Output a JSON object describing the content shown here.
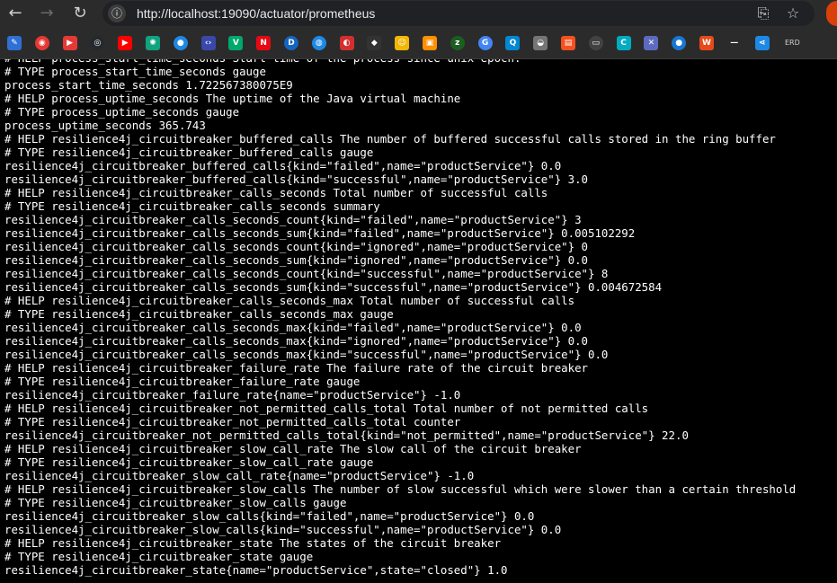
{
  "address_bar": {
    "url": "http://localhost:19090/actuator/prometheus"
  },
  "bookmarks": [
    {
      "name": "bookmark-editor-icon",
      "glyph": "✎",
      "color": "#2f6fd6"
    },
    {
      "name": "bookmark-mail-icon",
      "glyph": "◉",
      "color": "#e53935"
    },
    {
      "name": "bookmark-music-icon",
      "glyph": "▶",
      "color": "#e53935"
    },
    {
      "name": "bookmark-github-icon",
      "glyph": "◎",
      "color": "#24292e"
    },
    {
      "name": "bookmark-youtube-icon",
      "glyph": "▶",
      "color": "#ff0000"
    },
    {
      "name": "bookmark-ai-icon",
      "glyph": "✺",
      "color": "#10a37f"
    },
    {
      "name": "bookmark-globe-icon",
      "glyph": "●",
      "color": "#1e88e5"
    },
    {
      "name": "bookmark-code-icon",
      "glyph": "‹›",
      "color": "#3949ab"
    },
    {
      "name": "bookmark-v-icon",
      "glyph": "V",
      "color": "#00a86b"
    },
    {
      "name": "bookmark-netflix-icon",
      "glyph": "N",
      "color": "#e50914"
    },
    {
      "name": "bookmark-d-icon",
      "glyph": "D",
      "color": "#1565c0"
    },
    {
      "name": "bookmark-circle-icon",
      "glyph": "◍",
      "color": "#1e88e5"
    },
    {
      "name": "bookmark-red-icon",
      "glyph": "◐",
      "color": "#d32f2f"
    },
    {
      "name": "bookmark-diamond-icon",
      "glyph": "◆",
      "color": "#333333"
    },
    {
      "name": "bookmark-emoji-icon",
      "glyph": "☺",
      "color": "#f2b705"
    },
    {
      "name": "bookmark-image-icon",
      "glyph": "▣",
      "color": "#ff8f00"
    },
    {
      "name": "bookmark-z-icon",
      "glyph": "z",
      "color": "#1b5e20"
    },
    {
      "name": "bookmark-translate-icon",
      "glyph": "G",
      "color": "#4285f4"
    },
    {
      "name": "bookmark-q-icon",
      "glyph": "Q",
      "color": "#0288d1"
    },
    {
      "name": "bookmark-web-icon",
      "glyph": "◒",
      "color": "#757575"
    },
    {
      "name": "bookmark-box-icon",
      "glyph": "▤",
      "color": "#f4511e"
    },
    {
      "name": "bookmark-laptop-icon",
      "glyph": "▭",
      "color": "#424242"
    },
    {
      "name": "bookmark-c-icon",
      "glyph": "C",
      "color": "#00acc1"
    },
    {
      "name": "bookmark-cross-icon",
      "glyph": "✕",
      "color": "#5c6bc0"
    },
    {
      "name": "bookmark-sphere-icon",
      "glyph": "●",
      "color": "#1976d2"
    },
    {
      "name": "bookmark-w-icon",
      "glyph": "W",
      "color": "#e64a19"
    },
    {
      "name": "bookmark-dash-icon",
      "glyph": "—",
      "color": "#2b2b2b"
    },
    {
      "name": "bookmark-share-icon",
      "glyph": "⋖",
      "color": "#1e88e5"
    },
    {
      "name": "bookmark-erd",
      "glyph": "ERD",
      "color": "#2b2b2b"
    }
  ],
  "metrics_lines": [
    "# HELP process_start_time_seconds Start time of the process since unix epoch.",
    "# TYPE process_start_time_seconds gauge",
    "process_start_time_seconds 1.722567380075E9",
    "# HELP process_uptime_seconds The uptime of the Java virtual machine",
    "# TYPE process_uptime_seconds gauge",
    "process_uptime_seconds 365.743",
    "# HELP resilience4j_circuitbreaker_buffered_calls The number of buffered successful calls stored in the ring buffer",
    "# TYPE resilience4j_circuitbreaker_buffered_calls gauge",
    "resilience4j_circuitbreaker_buffered_calls{kind=\"failed\",name=\"productService\"} 0.0",
    "resilience4j_circuitbreaker_buffered_calls{kind=\"successful\",name=\"productService\"} 3.0",
    "# HELP resilience4j_circuitbreaker_calls_seconds Total number of successful calls",
    "# TYPE resilience4j_circuitbreaker_calls_seconds summary",
    "resilience4j_circuitbreaker_calls_seconds_count{kind=\"failed\",name=\"productService\"} 3",
    "resilience4j_circuitbreaker_calls_seconds_sum{kind=\"failed\",name=\"productService\"} 0.005102292",
    "resilience4j_circuitbreaker_calls_seconds_count{kind=\"ignored\",name=\"productService\"} 0",
    "resilience4j_circuitbreaker_calls_seconds_sum{kind=\"ignored\",name=\"productService\"} 0.0",
    "resilience4j_circuitbreaker_calls_seconds_count{kind=\"successful\",name=\"productService\"} 8",
    "resilience4j_circuitbreaker_calls_seconds_sum{kind=\"successful\",name=\"productService\"} 0.004672584",
    "# HELP resilience4j_circuitbreaker_calls_seconds_max Total number of successful calls",
    "# TYPE resilience4j_circuitbreaker_calls_seconds_max gauge",
    "resilience4j_circuitbreaker_calls_seconds_max{kind=\"failed\",name=\"productService\"} 0.0",
    "resilience4j_circuitbreaker_calls_seconds_max{kind=\"ignored\",name=\"productService\"} 0.0",
    "resilience4j_circuitbreaker_calls_seconds_max{kind=\"successful\",name=\"productService\"} 0.0",
    "# HELP resilience4j_circuitbreaker_failure_rate The failure rate of the circuit breaker",
    "# TYPE resilience4j_circuitbreaker_failure_rate gauge",
    "resilience4j_circuitbreaker_failure_rate{name=\"productService\"} -1.0",
    "# HELP resilience4j_circuitbreaker_not_permitted_calls_total Total number of not permitted calls",
    "# TYPE resilience4j_circuitbreaker_not_permitted_calls_total counter",
    "resilience4j_circuitbreaker_not_permitted_calls_total{kind=\"not_permitted\",name=\"productService\"} 22.0",
    "# HELP resilience4j_circuitbreaker_slow_call_rate The slow call of the circuit breaker",
    "# TYPE resilience4j_circuitbreaker_slow_call_rate gauge",
    "resilience4j_circuitbreaker_slow_call_rate{name=\"productService\"} -1.0",
    "# HELP resilience4j_circuitbreaker_slow_calls The number of slow successful which were slower than a certain threshold",
    "# TYPE resilience4j_circuitbreaker_slow_calls gauge",
    "resilience4j_circuitbreaker_slow_calls{kind=\"failed\",name=\"productService\"} 0.0",
    "resilience4j_circuitbreaker_slow_calls{kind=\"successful\",name=\"productService\"} 0.0",
    "# HELP resilience4j_circuitbreaker_state The states of the circuit breaker",
    "# TYPE resilience4j_circuitbreaker_state gauge",
    "resilience4j_circuitbreaker_state{name=\"productService\",state=\"closed\"} 1.0"
  ]
}
